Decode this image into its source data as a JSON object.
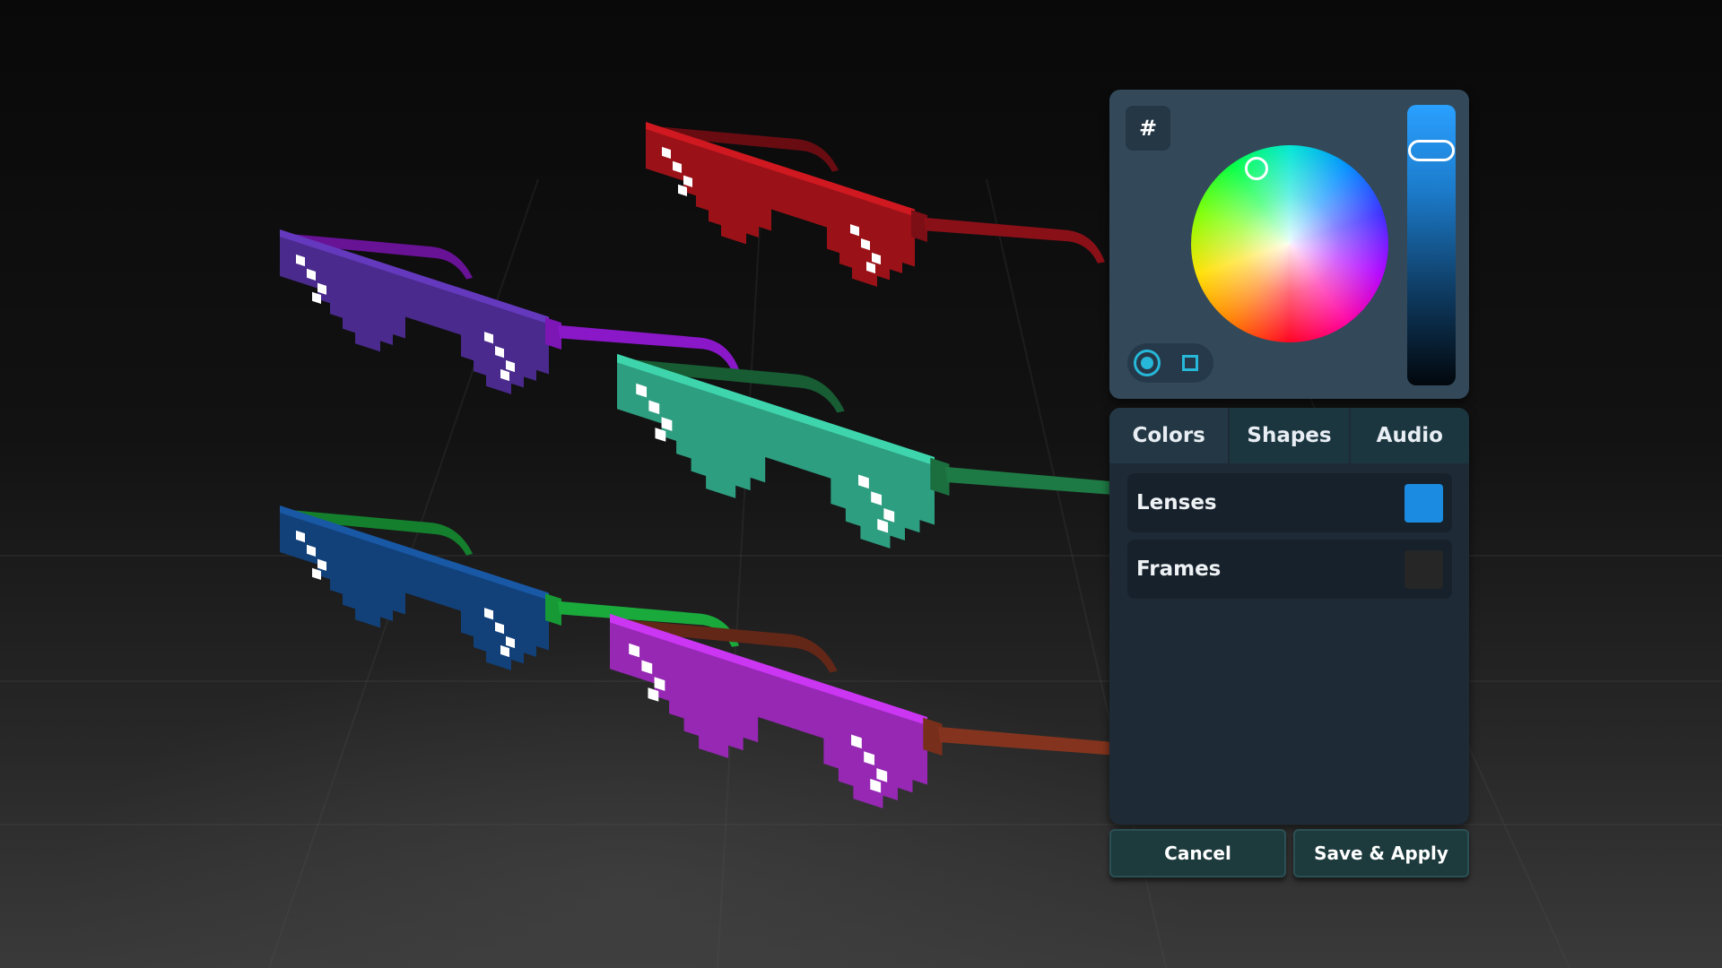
{
  "picker": {
    "hex_label": "#",
    "brightness_percent": 90
  },
  "tabs": [
    {
      "label": "Colors"
    },
    {
      "label": "Shapes"
    },
    {
      "label": "Audio"
    }
  ],
  "rows": [
    {
      "label": "Lenses",
      "color": "#1a8be0"
    },
    {
      "label": "Frames",
      "color": "#262626"
    }
  ],
  "buttons": {
    "cancel_label": "Cancel",
    "save_label": "Save & Apply"
  },
  "colors": {
    "picker_card": "#33495a",
    "settings_card": "#1e2a35",
    "accent": "#27b7d8"
  },
  "glasses": [
    {
      "lens": "#4a2a8c",
      "arm": "#8a18c8"
    },
    {
      "lens": "#9a1218",
      "arm": "#8a1018"
    },
    {
      "lens": "#2e9e80",
      "arm": "#1e7a44"
    },
    {
      "lens": "#12417a",
      "arm": "#1aaa3c"
    },
    {
      "lens": "#9628b4",
      "arm": "#84341e"
    }
  ]
}
